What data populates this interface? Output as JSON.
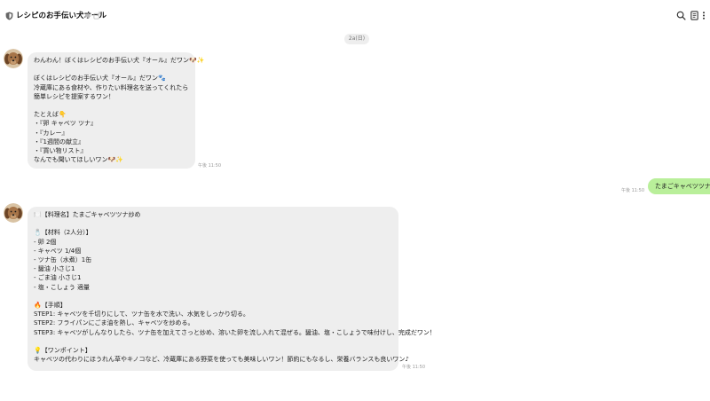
{
  "header": {
    "title": "レシピのお手伝い犬オール",
    "icons": [
      "shield-icon",
      "mute-icon",
      "share-icon",
      "search-icon",
      "note-icon",
      "more-icon"
    ]
  },
  "chat": {
    "date": "2a(日)",
    "messages": [
      {
        "sender": "bot",
        "text": "わんわん！ぼくはレシピのお手伝い犬『オール』だワン🐶✨\n\nぼくはレシピのお手伝い犬『オール』だワン🐾\n冷蔵庫にある食材や、作りたい料理名を送ってくれたら\n簡単レシピを提案するワン！\n\nたとえば👇\n・『卵 キャベツ ツナ』\n・『カレー』\n・『1週間の献立』\n・『買い物リスト』\nなんでも聞いてほしいワン🐶✨",
        "time": "午後 11:50"
      },
      {
        "sender": "user",
        "text": "たまごキャベツツナ",
        "time": "午後 11:50"
      },
      {
        "sender": "bot",
        "text": "🍽️【料理名】たまごキャベツツナ炒め\n\n🧂【材料（2人分）】\n- 卵 2個\n- キャベツ 1/4個\n- ツナ缶（水煮）1缶\n- 醤油 小さじ1\n- ごま油 小さじ1\n- 塩・こしょう 適量\n\n🔥【手順】\nSTEP1: キャベツを千切りにして、ツナ缶を水で洗い、水気をしっかり切る。\nSTEP2: フライパンにごま油を熱し、キャベツを炒める。\nSTEP3: キャベツがしんなりしたら、ツナ缶を加えてさっと炒め、溶いた卵を流し入れて混ぜる。醤油、塩・こしょうで味付けし、完成だワン！\n\n💡【ワンポイント】\nキャベツの代わりにほうれん草やキノコなど、冷蔵庫にある野菜を使っても美味しいワン！節約にもなるし、栄養バランスも良いワン♪",
        "time": "午後 11:50"
      }
    ]
  }
}
